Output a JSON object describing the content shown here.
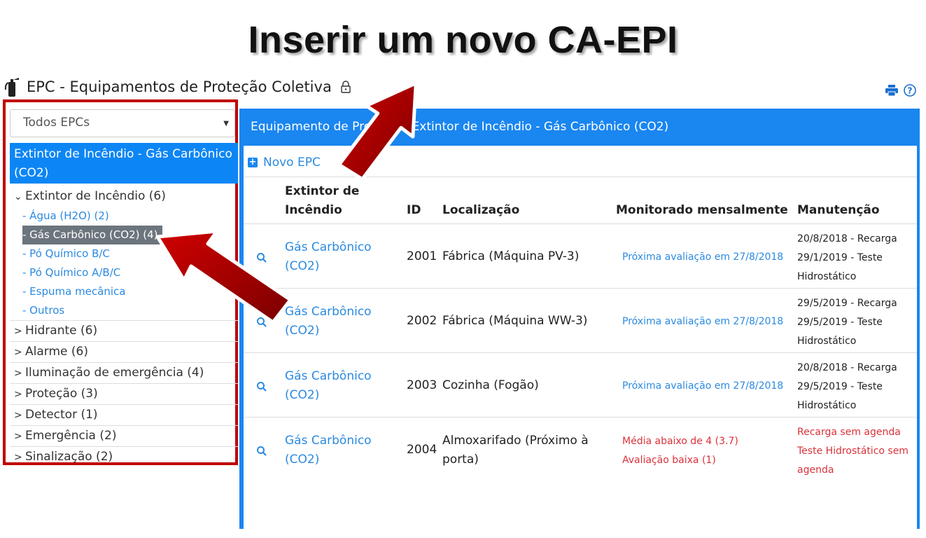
{
  "slide_title": "Inserir um novo CA-EPI",
  "app": {
    "title": "EPC - Equipamentos de Proteção Coletiva",
    "icons": [
      "fire-extinguisher-icon",
      "lock-icon",
      "print-icon",
      "help-icon"
    ]
  },
  "sidebar": {
    "select_value": "Todos EPCs",
    "active_group": "Extintor de Incêndio - Gás Carbônico (CO2)",
    "groups": [
      {
        "label": "Extintor de Incêndio (6)",
        "expanded": true,
        "items": [
          "- Água (H2O) (2)",
          "- Gás Carbônico (CO2) (4)",
          "- Pó Químico B/C",
          "- Pó Químico A/B/C",
          "- Espuma mecânica",
          "- Outros"
        ]
      },
      {
        "label": "Hidrante (6)"
      },
      {
        "label": "Alarme (6)"
      },
      {
        "label": "Iluminação de emergência (4)"
      },
      {
        "label": "Proteção (3)"
      },
      {
        "label": "Detector (1)"
      },
      {
        "label": "Emergência (2)"
      },
      {
        "label": "Sinalização (2)"
      }
    ]
  },
  "panel": {
    "header": "Equipamento de Proteção: Extintor de Incêndio - Gás Carbônico (CO2)",
    "new_button": "Novo EPC",
    "columns": [
      "Extintor de Incêndio",
      "ID",
      "Localização",
      "Monitorado mensalmente",
      "Manutenção"
    ],
    "rows": [
      {
        "type": "Gás Carbônico (CO2)",
        "id": "2001",
        "location": "Fábrica (Máquina PV-3)",
        "monitor": [
          "Próxima avaliação em 27/8/2018"
        ],
        "monitor_status": "ok",
        "maintenance": [
          "20/8/2018 - Recarga",
          "29/1/2019 - Teste Hidrostático"
        ],
        "maintenance_status": "ok"
      },
      {
        "type": "Gás Carbônico (CO2)",
        "id": "2002",
        "location": "Fábrica (Máquina WW-3)",
        "monitor": [
          "Próxima avaliação em 27/8/2018"
        ],
        "monitor_status": "ok",
        "maintenance": [
          "29/5/2019 - Recarga",
          "29/5/2019 - Teste Hidrostático"
        ],
        "maintenance_status": "ok"
      },
      {
        "type": "Gás Carbônico (CO2)",
        "id": "2003",
        "location": "Cozinha (Fogão)",
        "monitor": [
          "Próxima avaliação em 27/8/2018"
        ],
        "monitor_status": "ok",
        "maintenance": [
          "20/8/2018 - Recarga",
          "29/5/2019 - Teste Hidrostático"
        ],
        "maintenance_status": "ok"
      },
      {
        "type": "Gás Carbônico (CO2)",
        "id": "2004",
        "location": "Almoxarifado (Próximo à porta)",
        "monitor": [
          "Média abaixo de 4 (3.7)",
          "Avaliação baixa (1)"
        ],
        "monitor_status": "alert",
        "maintenance": [
          "Recarga sem agenda",
          "Teste Hidrostático sem agenda"
        ],
        "maintenance_status": "alert"
      }
    ]
  },
  "colors": {
    "primary": "#1a86f0",
    "link": "#2b8ae0",
    "alert": "#d9323a",
    "highlight_border": "#c00000",
    "arrow": "#b00000"
  }
}
